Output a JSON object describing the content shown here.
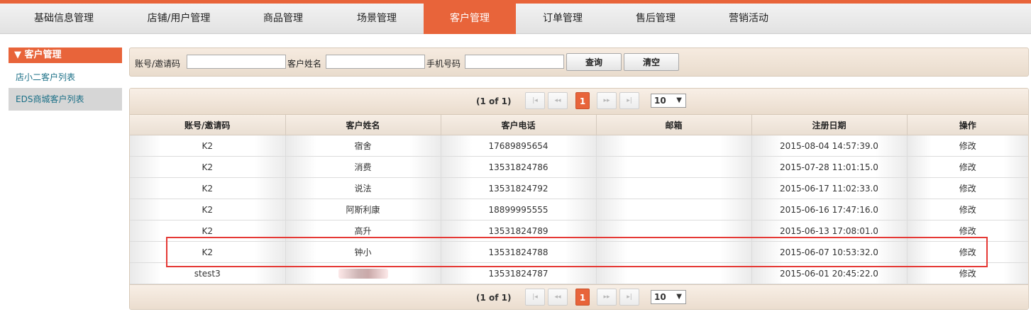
{
  "topnav": {
    "items": [
      {
        "label": "基础信息管理"
      },
      {
        "label": "店铺/用户管理"
      },
      {
        "label": "商品管理"
      },
      {
        "label": "场景管理"
      },
      {
        "label": "客户管理"
      },
      {
        "label": "订单管理"
      },
      {
        "label": "售后管理"
      },
      {
        "label": "营销活动"
      }
    ],
    "active_index": 4
  },
  "sidebar": {
    "header": "▼ 客户管理",
    "items": [
      {
        "label": "店小二客户列表"
      },
      {
        "label": "EDS商城客户列表"
      }
    ]
  },
  "search": {
    "account_label": "账号/邀请码",
    "account_value": "",
    "name_label": "客户姓名",
    "name_value": "",
    "phone_label": "手机号码",
    "phone_value": "",
    "query_button": "查询",
    "clear_button": "清空"
  },
  "pager": {
    "page_info": "(1 of 1)",
    "current_page": "1",
    "page_size": "10",
    "first_icon": "first-page-icon",
    "prev_icon": "prev-page-icon",
    "next_icon": "next-page-icon",
    "last_icon": "last-page-icon"
  },
  "table": {
    "columns": [
      "账号/邀请码",
      "客户姓名",
      "客户电话",
      "邮箱",
      "注册日期",
      "操作"
    ],
    "rows": [
      {
        "account": "K2",
        "name": "宿舍",
        "phone": "17689895654",
        "email": "",
        "date": "2015-08-04 14:57:39.0",
        "action": "修改"
      },
      {
        "account": "K2",
        "name": "消费",
        "phone": "13531824786",
        "email": "",
        "date": "2015-07-28 11:01:15.0",
        "action": "修改"
      },
      {
        "account": "K2",
        "name": "说法",
        "phone": "13531824792",
        "email": "",
        "date": "2015-06-17 11:02:33.0",
        "action": "修改"
      },
      {
        "account": "K2",
        "name": "阿斯利康",
        "phone": "18899995555",
        "email": "",
        "date": "2015-06-16 17:47:16.0",
        "action": "修改"
      },
      {
        "account": "K2",
        "name": "高升",
        "phone": "13531824789",
        "email": "",
        "date": "2015-06-13 17:08:01.0",
        "action": "修改"
      },
      {
        "account": "K2",
        "name": "钟小",
        "phone": "13531824788",
        "email": "",
        "date": "2015-06-07 10:53:32.0",
        "action": "修改"
      },
      {
        "account": "stest3",
        "name": "",
        "phone": "13531824787",
        "email": "",
        "date": "2015-06-01 20:45:22.0",
        "action": "修改"
      }
    ]
  },
  "colors": {
    "accent": "#e8643a",
    "highlight_border": "#e53935",
    "sidebar_link": "#1a6f86"
  }
}
